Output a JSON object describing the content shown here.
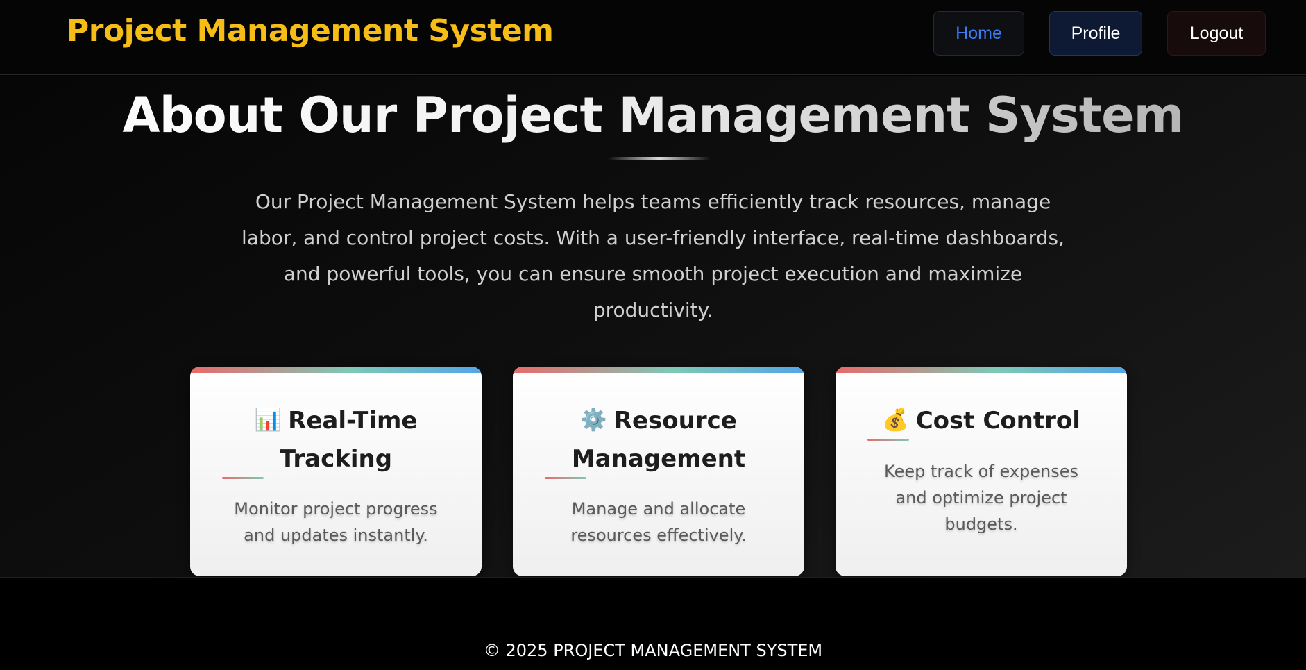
{
  "header": {
    "brand": "Project Management System",
    "nav": {
      "home": "Home",
      "profile": "Profile",
      "logout": "Logout"
    }
  },
  "about": {
    "title": "About Our Project Management System",
    "description": "Our Project Management System helps teams efficiently track resources, manage labor, and control project costs. With a user-friendly interface, real-time dashboards, and powerful tools, you can ensure smooth project execution and maximize productivity."
  },
  "features": [
    {
      "icon": "bar-chart-icon",
      "icon_glyph": "📊",
      "title": "Real-Time Tracking",
      "description": "Monitor project progress and updates instantly."
    },
    {
      "icon": "gear-icon",
      "icon_glyph": "⚙️",
      "title": "Resource Management",
      "description": "Manage and allocate resources effectively."
    },
    {
      "icon": "money-bag-icon",
      "icon_glyph": "💰",
      "title": "Cost Control",
      "description": "Keep track of expenses and optimize project budgets."
    }
  ],
  "footer": {
    "copyright": "© 2025 PROJECT MANAGEMENT SYSTEM"
  },
  "colors": {
    "brand": "#f6bd16",
    "home_link": "#3d7bf0",
    "profile_button_bg": "#0e1a33",
    "logout_button_bg": "#180b0b",
    "card_accent": [
      "#e86a6a",
      "#7ec9b6",
      "#52a6e6"
    ]
  }
}
